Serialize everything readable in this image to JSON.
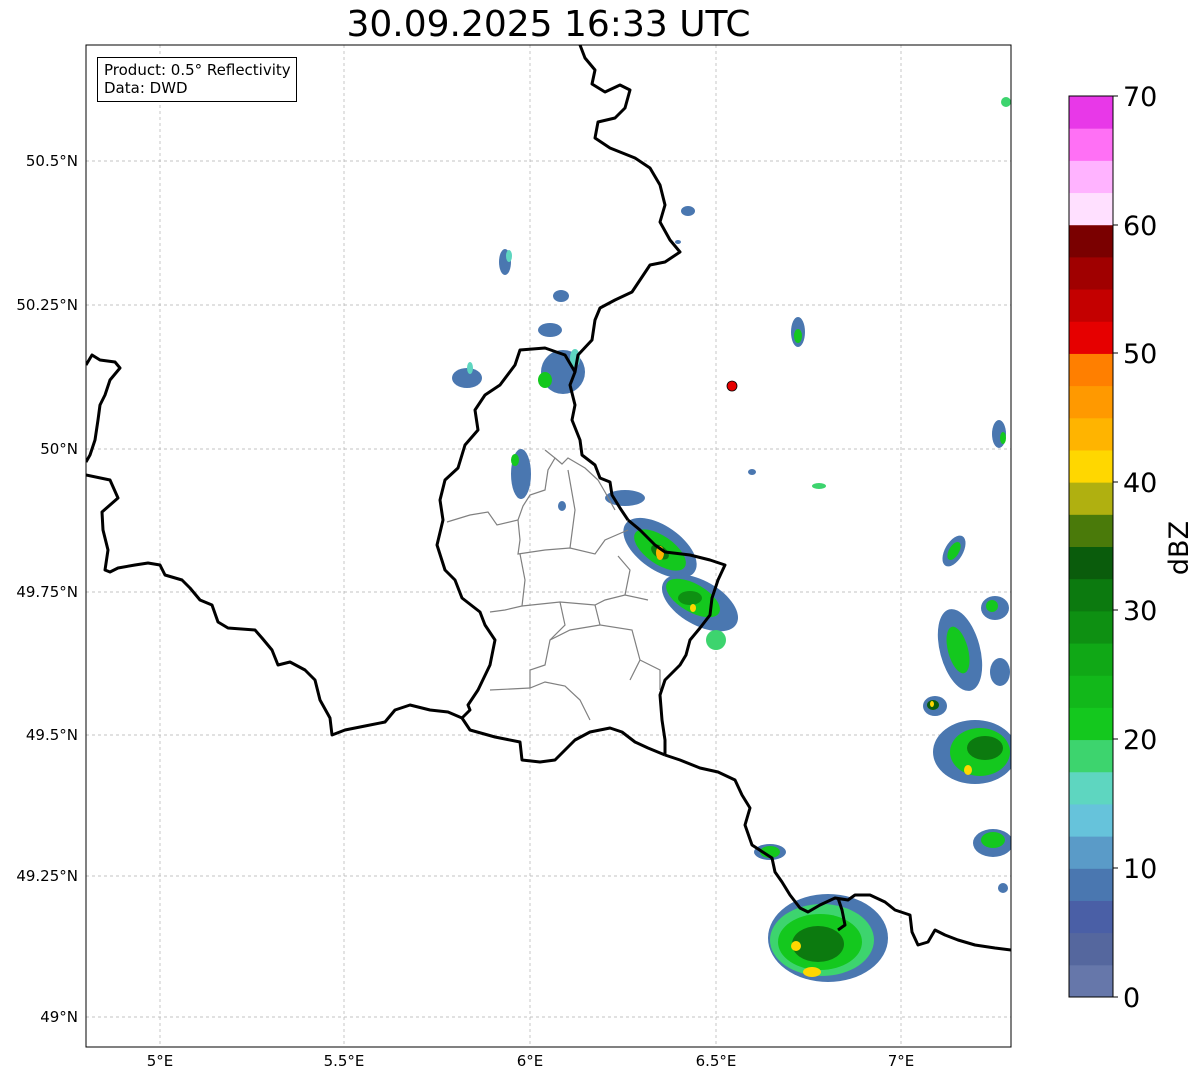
{
  "title": "30.09.2025 16:33 UTC",
  "info": {
    "product": "Product: 0.5° Reflectivity",
    "data": "Data: DWD"
  },
  "lat_ticks": [
    "50.5°N",
    "50.25°N",
    "50°N",
    "49.75°N",
    "49.5°N",
    "49.25°N",
    "49°N"
  ],
  "lon_ticks": [
    "5°E",
    "5.5°E",
    "6°E",
    "6.5°E",
    "7°E"
  ],
  "colorbar": {
    "label": "dBZ",
    "ticks": [
      "0",
      "10",
      "20",
      "30",
      "40",
      "50",
      "60",
      "70"
    ],
    "colors": [
      "#6677aa",
      "#55679e",
      "#4a5fa6",
      "#4a77b0",
      "#5a9bc8",
      "#66c3db",
      "#5ed6c0",
      "#3dd46e",
      "#14c81e",
      "#12b81a",
      "#10a816",
      "#0e9012",
      "#0c7a0f",
      "#0a5c0c",
      "#4a7a0a",
      "#b0b010",
      "#ffd700",
      "#ffb400",
      "#ff9900",
      "#ff7f00",
      "#e60000",
      "#c40000",
      "#a00000",
      "#7a0000",
      "#ffe0ff",
      "#ffb3ff",
      "#ff70f5",
      "#e838e8"
    ]
  },
  "marker": {
    "color": "#e60000",
    "lon": 6.55,
    "lat": 50.11
  },
  "colors": {
    "border": "#000000",
    "district": "#808080",
    "grid": "#b0b0b0"
  }
}
